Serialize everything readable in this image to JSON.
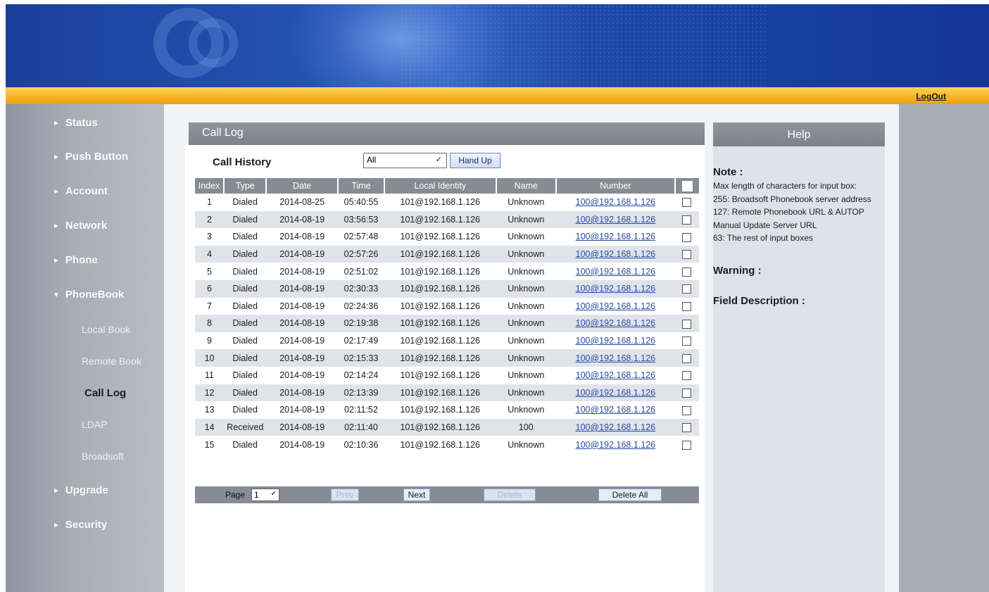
{
  "header": {
    "logout_label": "LogOut"
  },
  "sidebar": {
    "items": [
      {
        "label": "Status"
      },
      {
        "label": "Push Button"
      },
      {
        "label": "Account"
      },
      {
        "label": "Network"
      },
      {
        "label": "Phone"
      },
      {
        "label": "PhoneBook"
      },
      {
        "label": "Upgrade"
      },
      {
        "label": "Security"
      }
    ],
    "arrows": {
      "collapsed": "►",
      "expanded": "▼"
    },
    "phonebook_subitems": [
      {
        "label": "Local Book"
      },
      {
        "label": "Remote Book"
      },
      {
        "label": "Call Log"
      },
      {
        "label": "LDAP"
      },
      {
        "label": "Broadsoft"
      }
    ],
    "active_subitem": "Call Log"
  },
  "main": {
    "section_title": "Call Log",
    "call_history_label": "Call History",
    "filter": {
      "selected": "All"
    },
    "hand_up_label": "Hand Up",
    "table": {
      "columns": [
        "Index",
        "Type",
        "Date",
        "Time",
        "Local Identity",
        "Name",
        "Number"
      ],
      "rows": [
        [
          "1",
          "Dialed",
          "2014-08-25",
          "05:40:55",
          "101@192.168.1.126",
          "Unknown",
          "100@192.168.1.126"
        ],
        [
          "2",
          "Dialed",
          "2014-08-19",
          "03:56:53",
          "101@192.168.1.126",
          "Unknown",
          "100@192.168.1.126"
        ],
        [
          "3",
          "Dialed",
          "2014-08-19",
          "02:57:48",
          "101@192.168.1.126",
          "Unknown",
          "100@192.168.1.126"
        ],
        [
          "4",
          "Dialed",
          "2014-08-19",
          "02:57:26",
          "101@192.168.1.126",
          "Unknown",
          "100@192.168.1.126"
        ],
        [
          "5",
          "Dialed",
          "2014-08-19",
          "02:51:02",
          "101@192.168.1.126",
          "Unknown",
          "100@192.168.1.126"
        ],
        [
          "6",
          "Dialed",
          "2014-08-19",
          "02:30:33",
          "101@192.168.1.126",
          "Unknown",
          "100@192.168.1.126"
        ],
        [
          "7",
          "Dialed",
          "2014-08-19",
          "02:24:36",
          "101@192.168.1.126",
          "Unknown",
          "100@192.168.1.126"
        ],
        [
          "8",
          "Dialed",
          "2014-08-19",
          "02:19:38",
          "101@192.168.1.126",
          "Unknown",
          "100@192.168.1.126"
        ],
        [
          "9",
          "Dialed",
          "2014-08-19",
          "02:17:49",
          "101@192.168.1.126",
          "Unknown",
          "100@192.168.1.126"
        ],
        [
          "10",
          "Dialed",
          "2014-08-19",
          "02:15:33",
          "101@192.168.1.126",
          "Unknown",
          "100@192.168.1.126"
        ],
        [
          "11",
          "Dialed",
          "2014-08-19",
          "02:14:24",
          "101@192.168.1.126",
          "Unknown",
          "100@192.168.1.126"
        ],
        [
          "12",
          "Dialed",
          "2014-08-19",
          "02:13:39",
          "101@192.168.1.126",
          "Unknown",
          "100@192.168.1.126"
        ],
        [
          "13",
          "Dialed",
          "2014-08-19",
          "02:11:52",
          "101@192.168.1.126",
          "Unknown",
          "100@192.168.1.126"
        ],
        [
          "14",
          "Received",
          "2014-08-19",
          "02:11:40",
          "101@192.168.1.126",
          "100",
          "100@192.168.1.126"
        ],
        [
          "15",
          "Dialed",
          "2014-08-19",
          "02:10:36",
          "101@192.168.1.126",
          "Unknown",
          "100@192.168.1.126"
        ]
      ]
    },
    "pager": {
      "page_label": "Page",
      "page_selected": "1",
      "prev_label": "Prev",
      "next_label": "Next",
      "delete_label": "Delete",
      "delete_all_label": "Delete All"
    }
  },
  "help": {
    "title": "Help",
    "note_heading": "Note :",
    "note_lines": [
      "Max length of characters for input box:",
      "255: Broadsoft Phonebook server address",
      "127: Remote Phonebook URL & AUTOP Manual Update Server URL",
      "63: The rest of input boxes"
    ],
    "warning_heading": "Warning :",
    "field_description_heading": "Field Description :"
  },
  "colors": {
    "banner_blue": "#1f48a6",
    "orange_bar": "#f6b523",
    "sidebar_gray": "#a7adb5",
    "header_gray": "#868c94",
    "link_blue": "#2a4aa3",
    "alt_row": "#dfe4ea"
  }
}
